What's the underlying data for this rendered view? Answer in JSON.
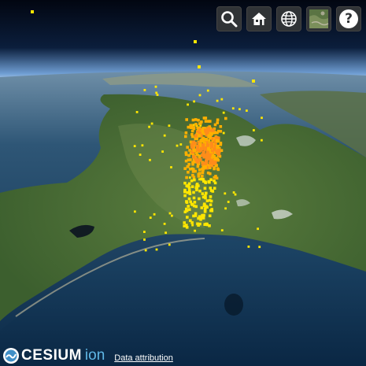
{
  "map": {
    "view": "3D globe, oblique aerial view",
    "basemap": "satellite imagery",
    "points": {
      "colors": {
        "high": "#ff8c1a",
        "mid": "#ffb000",
        "low": "#ffe600"
      }
    }
  },
  "toolbar": {
    "buttons": [
      {
        "name": "search-button",
        "icon": "magnifier-icon"
      },
      {
        "name": "home-button",
        "icon": "house-icon"
      },
      {
        "name": "scene-mode-button",
        "icon": "globe-icon"
      },
      {
        "name": "base-layer-picker-button",
        "icon": "imagery-thumbnail-icon"
      },
      {
        "name": "help-button",
        "icon": "question-icon",
        "glyph": "?"
      }
    ]
  },
  "credits": {
    "logo_main": "CESIUM",
    "logo_sub": "ion",
    "attribution_label": "Data attribution"
  }
}
